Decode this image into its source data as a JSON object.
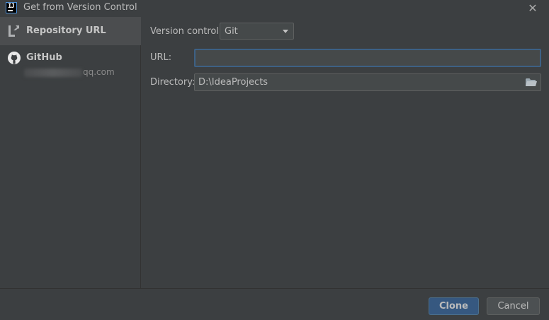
{
  "window": {
    "title": "Get from Version Control",
    "icon": "intellij-icon",
    "close_icon": "close-icon"
  },
  "sidebar": {
    "items": [
      {
        "label": "Repository URL",
        "icon": "repository-url-icon",
        "selected": true
      },
      {
        "label": "GitHub",
        "icon": "github-icon",
        "selected": false,
        "account_suffix": "qq.com"
      }
    ]
  },
  "form": {
    "version_control_label": "Version control:",
    "version_control_value": "Git",
    "url_label": "URL:",
    "url_value": "",
    "directory_label": "Directory:",
    "directory_value": "D:\\IdeaProjects"
  },
  "buttons": {
    "clone": "Clone",
    "cancel": "Cancel"
  },
  "colors": {
    "background": "#3c3f41",
    "selected_item": "#4b4d4f",
    "input_bg": "#45494a",
    "focus_border": "#3d6185",
    "primary_button": "#365880"
  }
}
